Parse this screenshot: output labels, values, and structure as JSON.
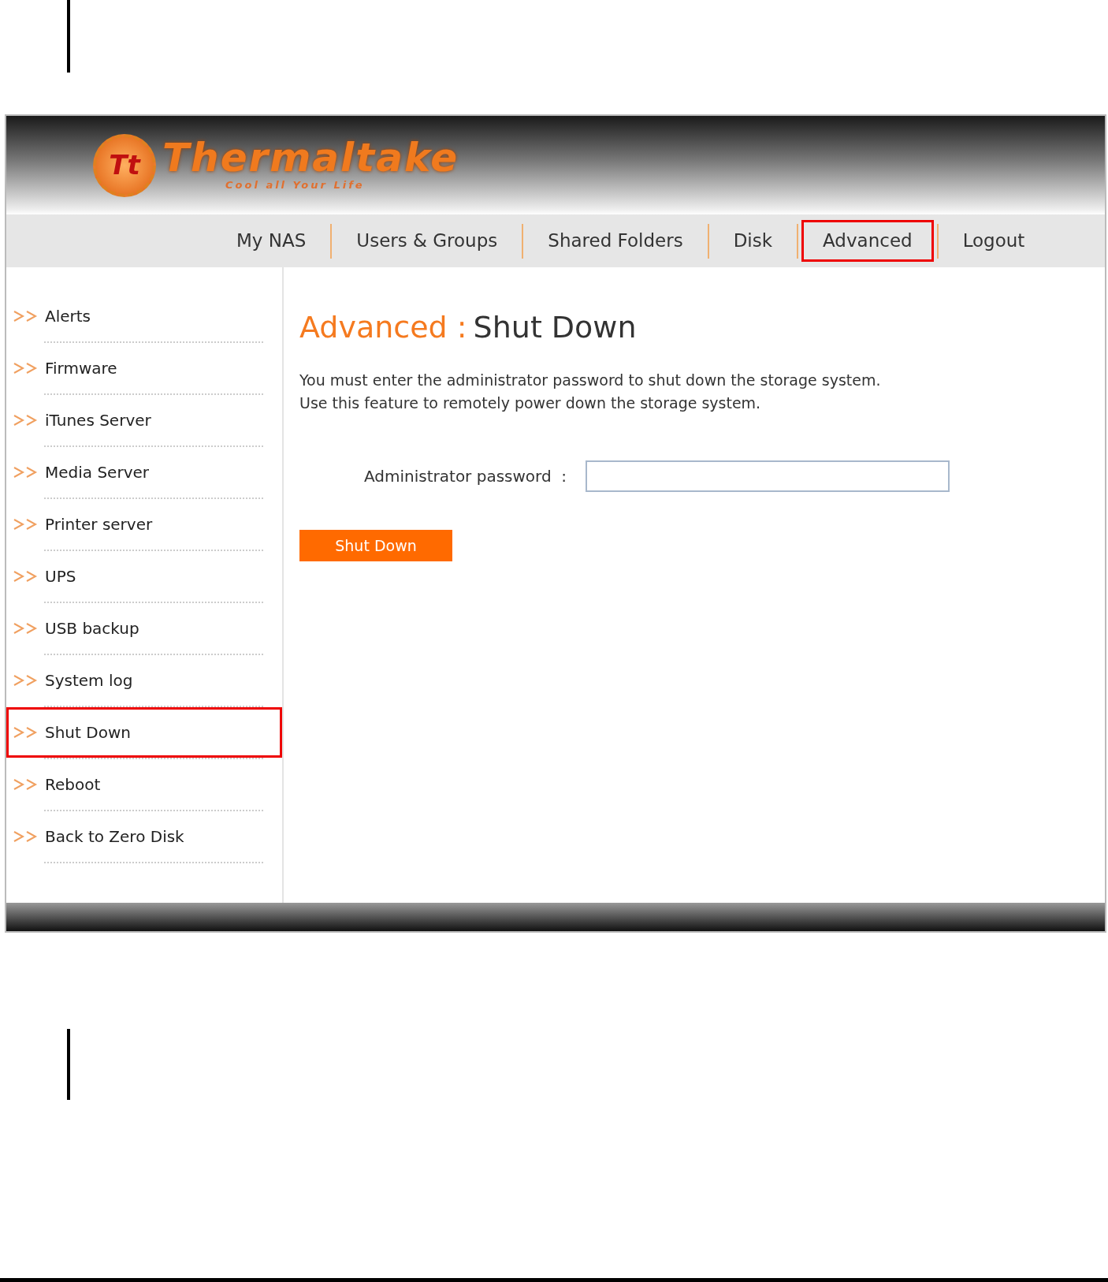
{
  "logo": {
    "mark": "Tt",
    "name": "Thermaltake",
    "tagline": "Cool **all** Your Life"
  },
  "nav": [
    {
      "label": "My NAS",
      "highlighted": false
    },
    {
      "label": "Users & Groups",
      "highlighted": false
    },
    {
      "label": "Shared Folders",
      "highlighted": false
    },
    {
      "label": "Disk",
      "highlighted": false
    },
    {
      "label": "Advanced",
      "highlighted": true
    },
    {
      "label": "Logout",
      "highlighted": false
    }
  ],
  "sidebar": {
    "items": [
      {
        "label": "Alerts",
        "highlighted": false
      },
      {
        "label": "Firmware",
        "highlighted": false
      },
      {
        "label": "iTunes Server",
        "highlighted": false
      },
      {
        "label": "Media Server",
        "highlighted": false
      },
      {
        "label": "Printer server",
        "highlighted": false
      },
      {
        "label": "UPS",
        "highlighted": false
      },
      {
        "label": "USB backup",
        "highlighted": false
      },
      {
        "label": "System log",
        "highlighted": false
      },
      {
        "label": "Shut Down",
        "highlighted": true
      },
      {
        "label": "Reboot",
        "highlighted": false
      },
      {
        "label": "Back to Zero Disk",
        "highlighted": false
      }
    ]
  },
  "content": {
    "section": "Advanced :",
    "title": "Shut Down",
    "description": [
      "You must enter the administrator password to shut down the storage system.",
      "Use this feature to remotely power down the storage system."
    ],
    "password_label": "Administrator password  :",
    "button": "Shut Down"
  }
}
